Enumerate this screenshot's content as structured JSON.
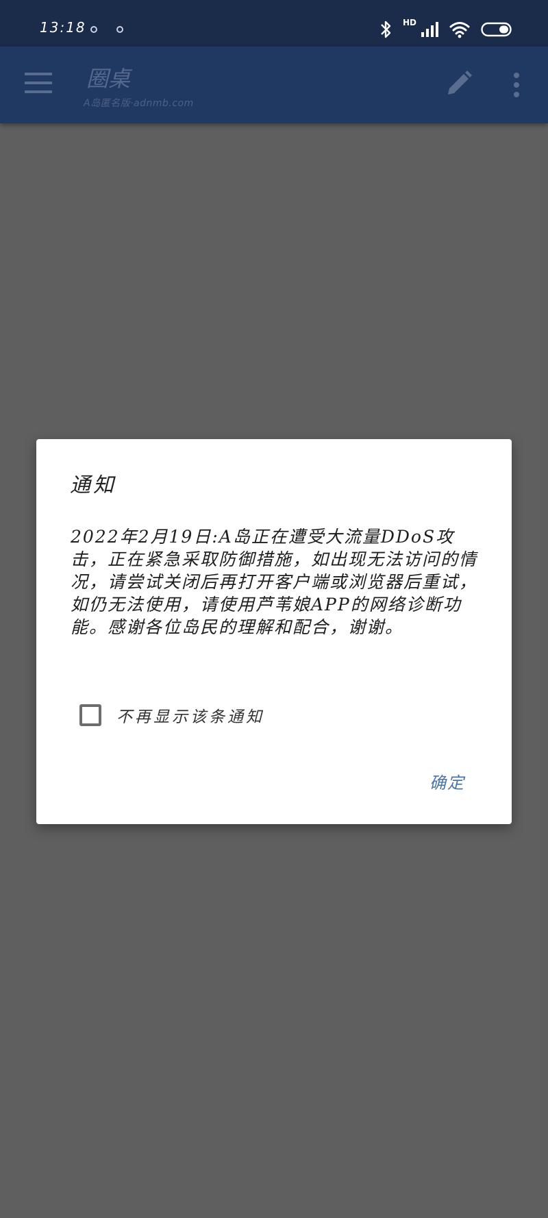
{
  "status_bar": {
    "time": "13:18",
    "network_label": "HD",
    "icons": [
      "notification-dot-icon",
      "notification-dot-icon",
      "bluetooth-icon",
      "signal-icon",
      "wifi-icon",
      "battery-icon"
    ]
  },
  "app_bar": {
    "title": "圈桌",
    "subtitle": "A岛匿名版·adnmb.com",
    "icons": [
      "menu-icon",
      "edit-icon",
      "more-vertical-icon"
    ],
    "color": "#203963"
  },
  "dialog": {
    "title": "通知",
    "message": "2022年2月19日:A岛正在遭受大流量DDoS攻击，正在紧急采取防御措施，如出现无法访问的情况，请尝试关闭后再打开客户端或浏览器后重试，如仍无法使用，请使用芦苇娘APP的网络诊断功能。感谢各位岛民的理解和配合，谢谢。",
    "checkbox_label": "不再显示该条通知",
    "checkbox_checked": false,
    "confirm_label": "确定",
    "accent_color": "#4a76a6"
  }
}
